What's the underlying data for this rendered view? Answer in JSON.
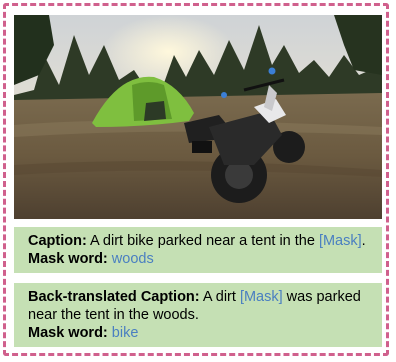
{
  "colors": {
    "frame_border": "#d0608d",
    "caption_bg": "#c5e0b4",
    "mask_text": "#4a7fc1"
  },
  "caption": {
    "label": "Caption:",
    "text_before": " A dirt bike parked near a tent in the ",
    "mask_token": "[Mask]",
    "text_after": ".",
    "mask_word_label": "Mask word:",
    "mask_word": "woods"
  },
  "back_translated": {
    "label": "Back-translated Caption:",
    "text_before": " A dirt ",
    "mask_token": "[Mask]",
    "text_after": " was parked",
    "text_line2": "near the tent in the woods.",
    "mask_word_label": "Mask word:",
    "mask_word": "bike"
  }
}
